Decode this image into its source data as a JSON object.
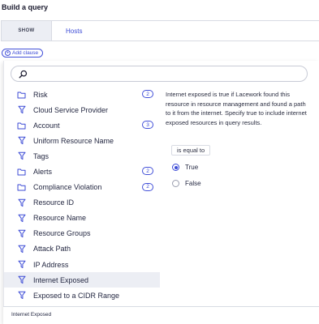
{
  "page": {
    "title": "Build a query"
  },
  "query": {
    "show_label": "SHOW",
    "show_value": "Hosts",
    "add_clause_label": "Add clause"
  },
  "search": {
    "placeholder": ""
  },
  "fields": [
    {
      "label": "Risk",
      "icon": "folder-icon",
      "count": "2"
    },
    {
      "label": "Cloud Service Provider",
      "icon": "filter-icon"
    },
    {
      "label": "Account",
      "icon": "folder-icon",
      "count": "3"
    },
    {
      "label": "Uniform Resource Name",
      "icon": "filter-icon"
    },
    {
      "label": "Tags",
      "icon": "filter-icon"
    },
    {
      "label": "Alerts",
      "icon": "folder-icon",
      "count": "2"
    },
    {
      "label": "Compliance Violation",
      "icon": "folder-icon",
      "count": "2"
    },
    {
      "label": "Resource ID",
      "icon": "filter-icon"
    },
    {
      "label": "Resource Name",
      "icon": "filter-icon"
    },
    {
      "label": "Resource Groups",
      "icon": "filter-icon"
    },
    {
      "label": "Attack Path",
      "icon": "filter-icon"
    },
    {
      "label": "IP Address",
      "icon": "filter-icon"
    },
    {
      "label": "Internet Exposed",
      "icon": "filter-icon",
      "selected": true
    },
    {
      "label": "Exposed to a CIDR Range",
      "icon": "filter-icon"
    }
  ],
  "detail": {
    "description": "Internet exposed is true if Lacework found this resource in resource management and found a path to it from the internet. Specify true to include internet exposed resources in query results.",
    "operator": "is equal to",
    "options": [
      {
        "label": "True",
        "checked": true
      },
      {
        "label": "False",
        "checked": false
      }
    ]
  },
  "footer": {
    "selected_label": "Internet Exposed"
  },
  "colors": {
    "accent": "#3c4bd6",
    "selected_row": "#eceef4"
  }
}
